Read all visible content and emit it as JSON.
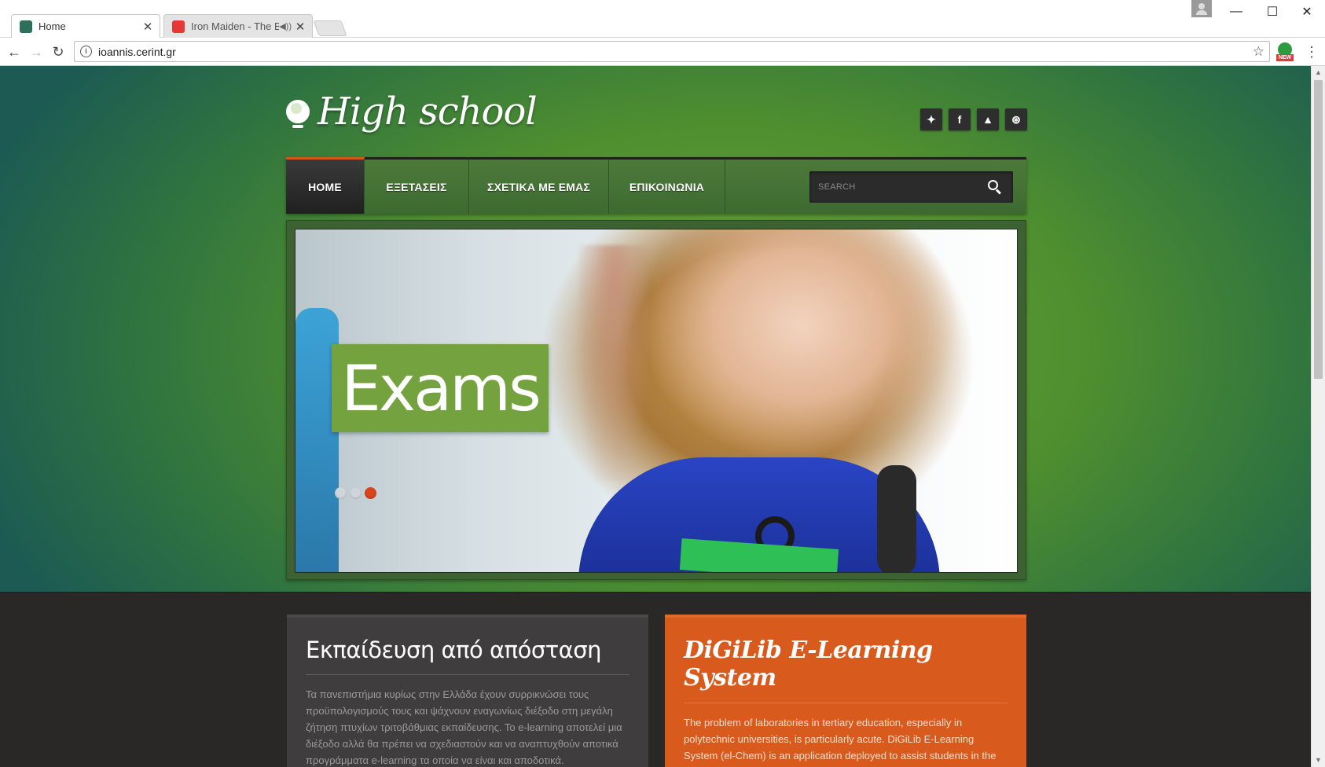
{
  "browser": {
    "tabs": [
      {
        "title": "Home",
        "active": true,
        "favicon_color": "#2d6f5a"
      },
      {
        "title": "Iron Maiden - The Bo",
        "active": false,
        "favicon_color": "#e53935"
      }
    ],
    "url": "ioannis.cerint.gr",
    "extension_badge": "NEW",
    "window_controls": {
      "minimize": "—",
      "maximize": "☐",
      "close": "✕"
    },
    "icons": {
      "back": "arrow-left-icon",
      "forward": "arrow-right-icon",
      "reload": "reload-icon",
      "bookmark": "star-icon",
      "menu": "kebab-menu-icon"
    }
  },
  "site": {
    "logo_text": "High school",
    "social": [
      {
        "name": "twitter",
        "glyph": "✦"
      },
      {
        "name": "facebook",
        "glyph": "f"
      },
      {
        "name": "alert",
        "glyph": "▲"
      },
      {
        "name": "dribbble",
        "glyph": "⊛"
      }
    ],
    "nav": [
      "HOME",
      "ΕΞΕΤΑΣΕΙΣ",
      "ΣΧΕΤΙΚΑ ΜΕ ΕΜΑΣ",
      "ΕΠΙΚΟΙΝΩΝΙΑ"
    ],
    "active_nav": "HOME",
    "search_placeholder": "SEARCH",
    "slider": {
      "caption": "Exams",
      "slide_count": 3,
      "current_slide": 3
    },
    "cards": {
      "left": {
        "title": "Εκπαίδευση από απόσταση",
        "text": "Τα πανεπιστήμια κυρίως στην Ελλάδα έχουν συρρικνώσει τους προϋπολογισμούς τους και ψάχνουν εναγωνίως διέξοδο στη μεγάλη ζήτηση πτυχίων τριτοβάθμιας εκπαίδευσης. Το e-learning αποτελεί μια διέξοδο αλλά θα πρέπει να σχεδιαστούν και να αναπτυχθούν αποτικά προγράμματα e-learning τα οποία να είναι και αποδοτικά."
      },
      "right": {
        "title": "DiGiLib E-Learning System",
        "text": "The problem of laboratories in tertiary education, especially in polytechnic universities, is particularly acute. DiGiLib E-Learning System (el-Chem) is an application deployed to assist students in the Aristotle University of Thessaloniki, Chemistry Department. A multi-agent system was used in this application, which is a great tool for"
      }
    },
    "colors": {
      "accent_orange": "#d95a1d",
      "nav_green": "#4d7a3a",
      "caption_green": "#74a23f",
      "dark_band": "#2a2727"
    }
  }
}
